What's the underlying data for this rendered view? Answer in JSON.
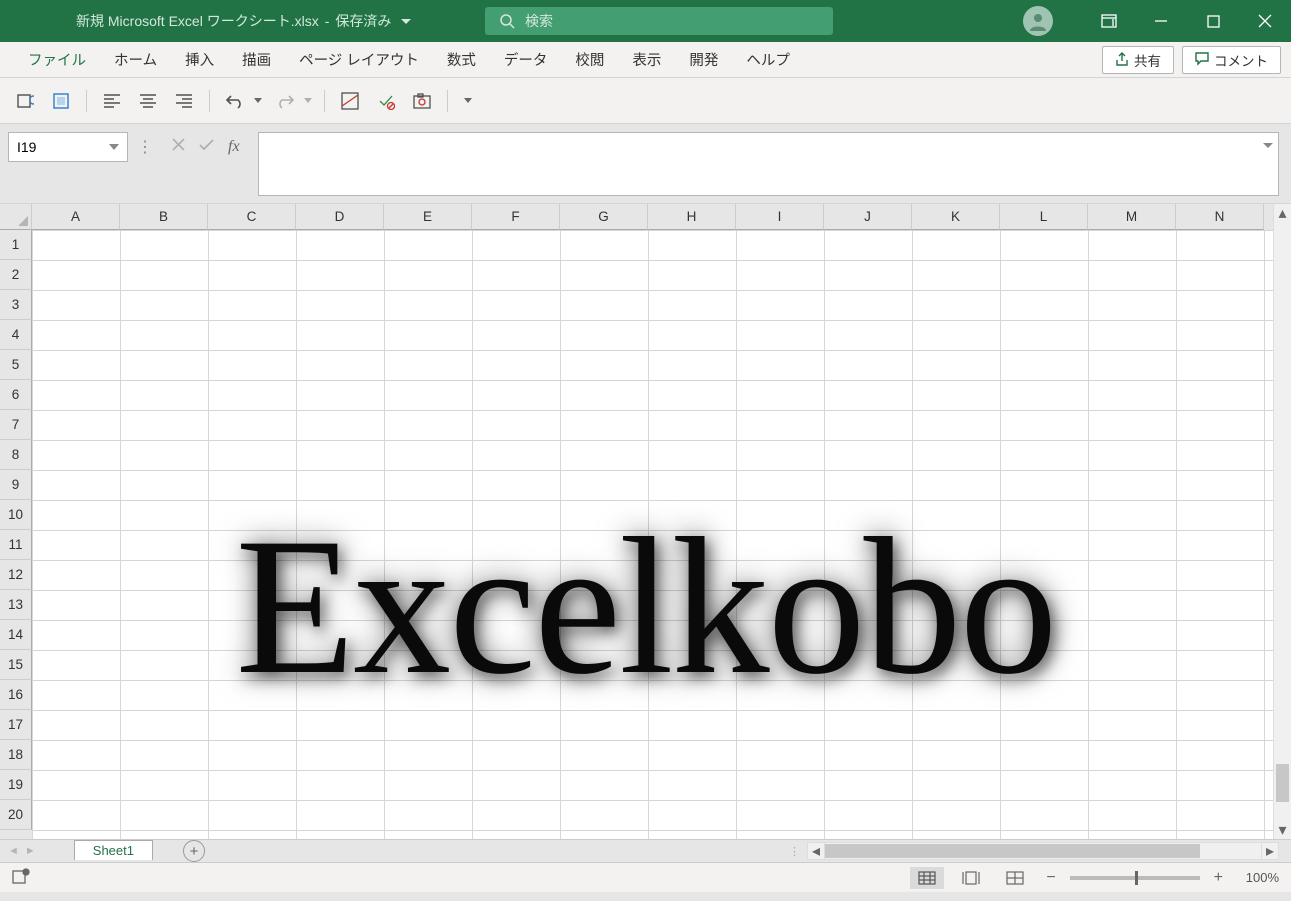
{
  "title": {
    "filename": "新規 Microsoft Excel ワークシート.xlsx",
    "status": "保存済み"
  },
  "search": {
    "placeholder": "検索"
  },
  "tabs": {
    "file": "ファイル",
    "home": "ホーム",
    "insert": "挿入",
    "draw": "描画",
    "layout": "ページ レイアウト",
    "formulas": "数式",
    "data": "データ",
    "review": "校閲",
    "view": "表示",
    "developer": "開発",
    "help": "ヘルプ"
  },
  "rightButtons": {
    "share": "共有",
    "comments": "コメント"
  },
  "nameBox": {
    "value": "I19"
  },
  "fx": {
    "label": "fx"
  },
  "columns": [
    "A",
    "B",
    "C",
    "D",
    "E",
    "F",
    "G",
    "H",
    "I",
    "J",
    "K",
    "L",
    "M",
    "N"
  ],
  "rows": [
    "1",
    "2",
    "3",
    "4",
    "5",
    "6",
    "7",
    "8",
    "9",
    "10",
    "11",
    "12",
    "13",
    "14",
    "15",
    "16",
    "17",
    "18",
    "19",
    "20"
  ],
  "watermark": {
    "text": "Excelkobo"
  },
  "sheet": {
    "name": "Sheet1"
  },
  "zoom": {
    "value": "100%"
  }
}
